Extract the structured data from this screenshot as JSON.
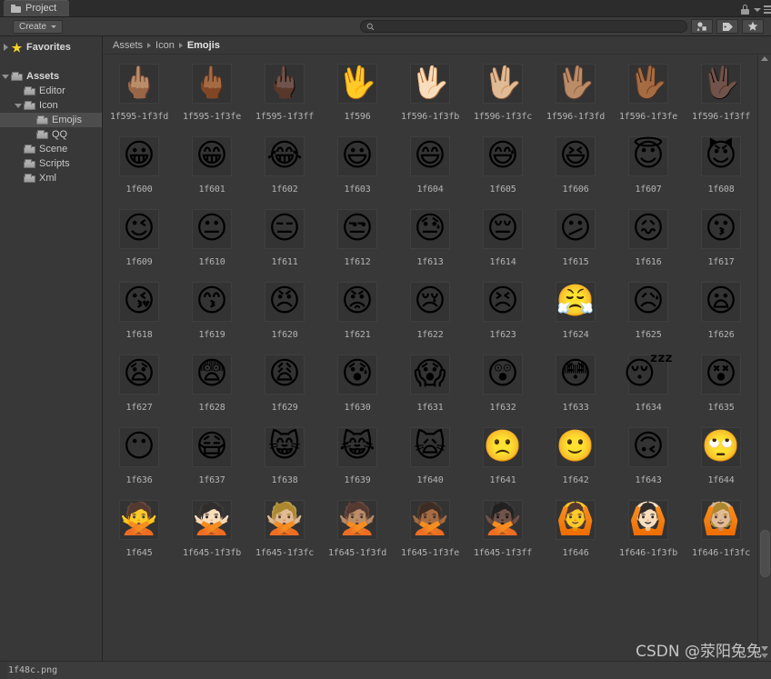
{
  "window": {
    "tab_title": "Project",
    "tab_icon": "folder-icon",
    "lock_icon": "lock-icon",
    "menu_icon": "hamburger-menu-icon"
  },
  "toolbar": {
    "create_label": "Create",
    "create_caret_icon": "chevron-down-icon",
    "search": {
      "placeholder": "",
      "value": "",
      "icon": "search-icon"
    },
    "filter_buttons": [
      {
        "name": "filter-by-type-icon",
        "glyph": "type"
      },
      {
        "name": "filter-by-label-icon",
        "glyph": "label"
      },
      {
        "name": "filter-favorites-icon",
        "glyph": "star"
      }
    ]
  },
  "sidebar": {
    "items": [
      {
        "label": "Favorites",
        "indent": 0,
        "twisty": "right",
        "icon": "star-icon",
        "bold": true,
        "selected": false
      },
      {
        "label": "",
        "indent": 0,
        "twisty": "none",
        "icon": "none",
        "bold": false,
        "selected": false
      },
      {
        "label": "Assets",
        "indent": 0,
        "twisty": "down",
        "icon": "folder-icon",
        "bold": true,
        "selected": false
      },
      {
        "label": "Editor",
        "indent": 1,
        "twisty": "none",
        "icon": "folder-icon",
        "bold": false,
        "selected": false
      },
      {
        "label": "Icon",
        "indent": 1,
        "twisty": "down",
        "icon": "folder-icon",
        "bold": false,
        "selected": false
      },
      {
        "label": "Emojis",
        "indent": 2,
        "twisty": "none",
        "icon": "folder-icon",
        "bold": false,
        "selected": true
      },
      {
        "label": "QQ",
        "indent": 2,
        "twisty": "none",
        "icon": "folder-icon",
        "bold": false,
        "selected": false
      },
      {
        "label": "Scene",
        "indent": 1,
        "twisty": "none",
        "icon": "folder-icon",
        "bold": false,
        "selected": false
      },
      {
        "label": "Scripts",
        "indent": 1,
        "twisty": "none",
        "icon": "folder-icon",
        "bold": false,
        "selected": false
      },
      {
        "label": "Xml",
        "indent": 1,
        "twisty": "none",
        "icon": "folder-icon",
        "bold": false,
        "selected": false
      }
    ]
  },
  "breadcrumb": {
    "separator_icon": "chevron-right-icon",
    "crumbs": [
      "Assets",
      "Icon",
      "Emojis"
    ],
    "current_index": 2
  },
  "grid": {
    "columns": 9,
    "items": [
      {
        "label": "1f595-1f3fd",
        "glyph": "🖕🏽"
      },
      {
        "label": "1f595-1f3fe",
        "glyph": "🖕🏾"
      },
      {
        "label": "1f595-1f3ff",
        "glyph": "🖕🏿"
      },
      {
        "label": "1f596",
        "glyph": "🖖"
      },
      {
        "label": "1f596-1f3fb",
        "glyph": "🖖🏻"
      },
      {
        "label": "1f596-1f3fc",
        "glyph": "🖖🏼"
      },
      {
        "label": "1f596-1f3fd",
        "glyph": "🖖🏽"
      },
      {
        "label": "1f596-1f3fe",
        "glyph": "🖖🏾"
      },
      {
        "label": "1f596-1f3ff",
        "glyph": "🖖🏿"
      },
      {
        "label": "1f600",
        "glyph": "😀"
      },
      {
        "label": "1f601",
        "glyph": "😁"
      },
      {
        "label": "1f602",
        "glyph": "😂"
      },
      {
        "label": "1f603",
        "glyph": "😃"
      },
      {
        "label": "1f604",
        "glyph": "😄"
      },
      {
        "label": "1f605",
        "glyph": "😅"
      },
      {
        "label": "1f606",
        "glyph": "😆"
      },
      {
        "label": "1f607",
        "glyph": "😇"
      },
      {
        "label": "1f608",
        "glyph": "😈"
      },
      {
        "label": "1f609",
        "glyph": "😉"
      },
      {
        "label": "1f610",
        "glyph": "😐"
      },
      {
        "label": "1f611",
        "glyph": "😑"
      },
      {
        "label": "1f612",
        "glyph": "😒"
      },
      {
        "label": "1f613",
        "glyph": "😓"
      },
      {
        "label": "1f614",
        "glyph": "😔"
      },
      {
        "label": "1f615",
        "glyph": "😕"
      },
      {
        "label": "1f616",
        "glyph": "😖"
      },
      {
        "label": "1f617",
        "glyph": "😗"
      },
      {
        "label": "1f618",
        "glyph": "😘"
      },
      {
        "label": "1f619",
        "glyph": "😙"
      },
      {
        "label": "1f620",
        "glyph": "😠"
      },
      {
        "label": "1f621",
        "glyph": "😡"
      },
      {
        "label": "1f622",
        "glyph": "😢"
      },
      {
        "label": "1f623",
        "glyph": "😣"
      },
      {
        "label": "1f624",
        "glyph": "😤"
      },
      {
        "label": "1f625",
        "glyph": "😥"
      },
      {
        "label": "1f626",
        "glyph": "😦"
      },
      {
        "label": "1f627",
        "glyph": "😧"
      },
      {
        "label": "1f628",
        "glyph": "😨"
      },
      {
        "label": "1f629",
        "glyph": "😩"
      },
      {
        "label": "1f630",
        "glyph": "😰"
      },
      {
        "label": "1f631",
        "glyph": "😱"
      },
      {
        "label": "1f632",
        "glyph": "😲"
      },
      {
        "label": "1f633",
        "glyph": "😳"
      },
      {
        "label": "1f634",
        "glyph": "😴"
      },
      {
        "label": "1f635",
        "glyph": "😵"
      },
      {
        "label": "1f636",
        "glyph": "😶"
      },
      {
        "label": "1f637",
        "glyph": "😷"
      },
      {
        "label": "1f638",
        "glyph": "😸"
      },
      {
        "label": "1f639",
        "glyph": "😹"
      },
      {
        "label": "1f640",
        "glyph": "🙀"
      },
      {
        "label": "1f641",
        "glyph": "🙁"
      },
      {
        "label": "1f642",
        "glyph": "🙂"
      },
      {
        "label": "1f643",
        "glyph": "🙃"
      },
      {
        "label": "1f644",
        "glyph": "🙄"
      },
      {
        "label": "1f645",
        "glyph": "🙅"
      },
      {
        "label": "1f645-1f3fb",
        "glyph": "🙅🏻"
      },
      {
        "label": "1f645-1f3fc",
        "glyph": "🙅🏼"
      },
      {
        "label": "1f645-1f3fd",
        "glyph": "🙅🏽"
      },
      {
        "label": "1f645-1f3fe",
        "glyph": "🙅🏾"
      },
      {
        "label": "1f645-1f3ff",
        "glyph": "🙅🏿"
      },
      {
        "label": "1f646",
        "glyph": "🙆"
      },
      {
        "label": "1f646-1f3fb",
        "glyph": "🙆🏻"
      },
      {
        "label": "1f646-1f3fc",
        "glyph": "🙆🏼"
      }
    ]
  },
  "scrollbar": {
    "up_arrow_icon": "triangle-up-icon",
    "down_arrow_icon": "triangle-down-icon"
  },
  "statusbar": {
    "selected_file": "1f48c.png",
    "resize_grip_icon": "triangle-down-icon"
  },
  "watermark": {
    "text": "CSDN @荥阳兔兔"
  },
  "colors": {
    "window_bg": "#383838",
    "panel_bg": "#3c3c3c",
    "tab_active": "#4a4a4a",
    "selection": "#4d4d4d",
    "text": "#c8c8c8",
    "favorite_star": "#f5d328"
  }
}
